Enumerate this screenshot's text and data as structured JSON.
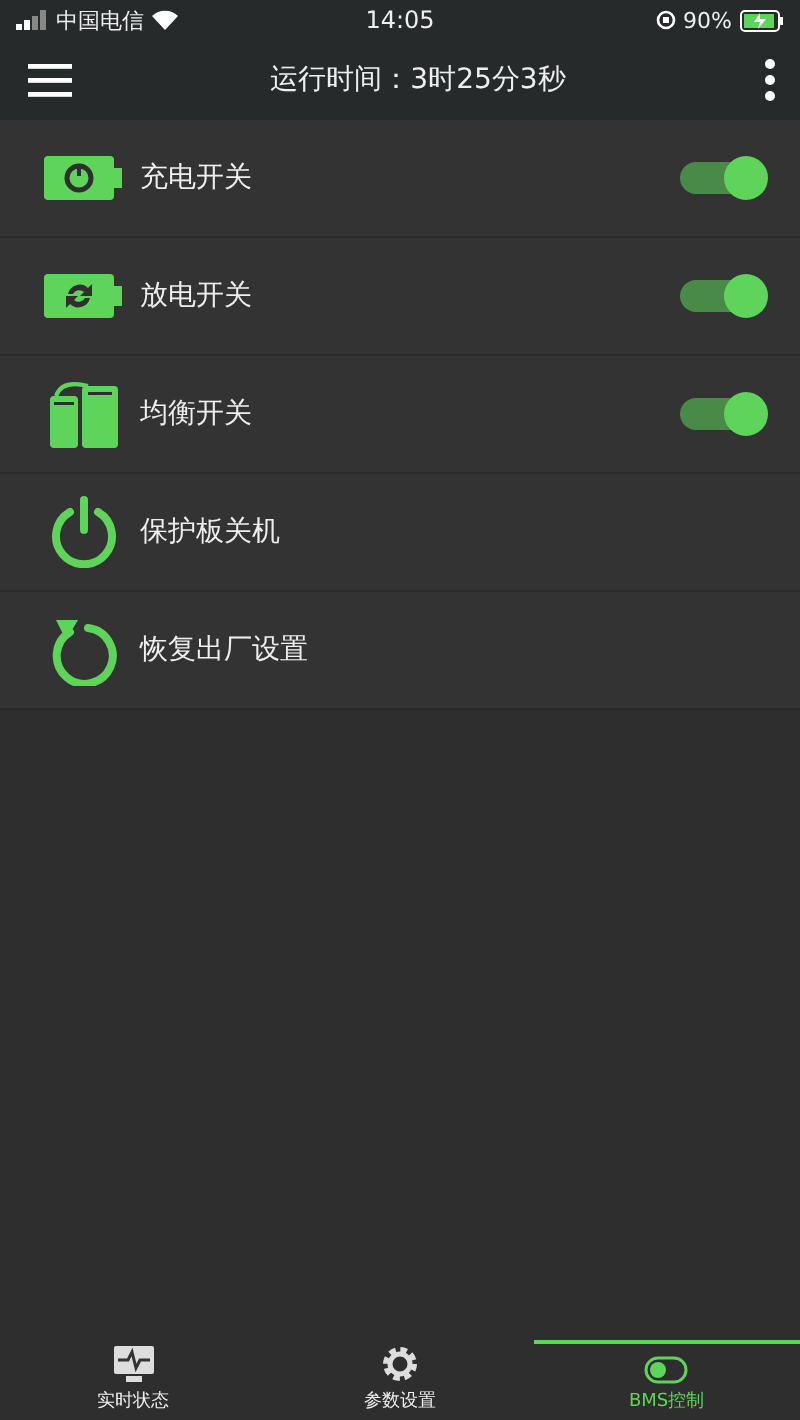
{
  "status_bar": {
    "carrier": "中国电信",
    "time": "14:05",
    "battery": "90%"
  },
  "header": {
    "title": "运行时间：3时25分3秒"
  },
  "rows": [
    {
      "kind": "toggle",
      "label": "充电开关",
      "on": true
    },
    {
      "kind": "toggle",
      "label": "放电开关",
      "on": true
    },
    {
      "kind": "toggle",
      "label": "均衡开关",
      "on": true
    },
    {
      "kind": "action",
      "label": "保护板关机"
    },
    {
      "kind": "action",
      "label": "恢复出厂设置"
    }
  ],
  "bottom_nav": [
    {
      "label": "实时状态",
      "selected": false
    },
    {
      "label": "参数设置",
      "selected": false
    },
    {
      "label": "BMS控制",
      "selected": true
    }
  ]
}
